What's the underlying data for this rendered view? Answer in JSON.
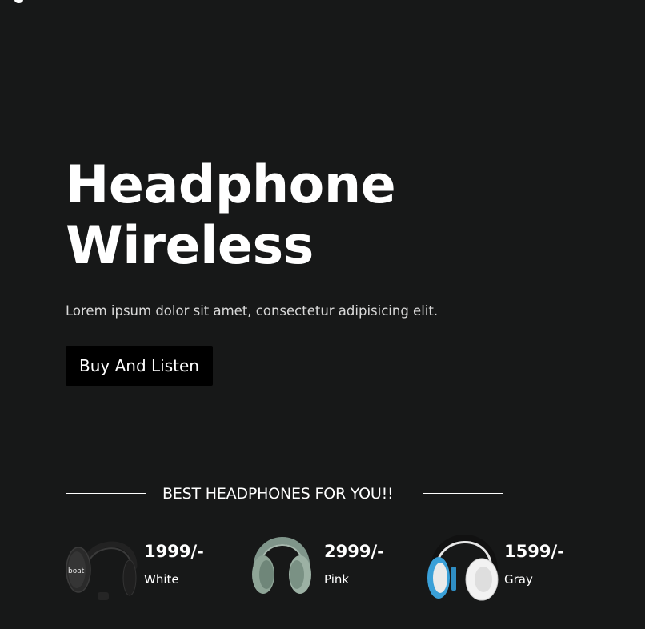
{
  "hero": {
    "title_line1": "Headphone",
    "title_line2": "Wireless",
    "subtitle": "Lorem ipsum dolor sit amet, consectetur adipisicing elit.",
    "cta_label": "Buy And Listen"
  },
  "section": {
    "heading": "BEST HEADPHONES FOR YOU!!"
  },
  "products": [
    {
      "price": "1999/-",
      "color": "White",
      "icon": "black-headphones-icon",
      "brand_mark": "boat"
    },
    {
      "price": "2999/-",
      "color": "Pink",
      "icon": "sage-headphones-icon"
    },
    {
      "price": "1599/-",
      "color": "Gray",
      "icon": "white-blue-headphones-icon"
    }
  ],
  "colors": {
    "background": "#171818",
    "button_background": "#000000",
    "text": "#ffffff",
    "subtitle_text": "#d9d9d9"
  }
}
